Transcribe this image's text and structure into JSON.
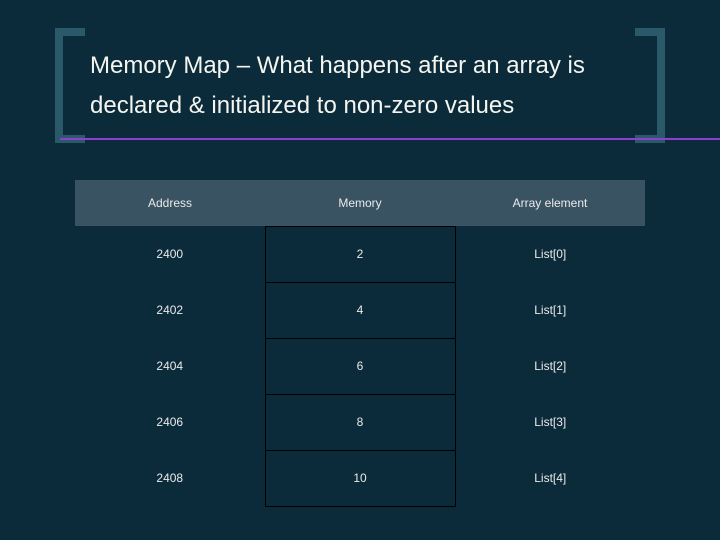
{
  "title": "Memory Map – What happens after an array is declared & initialized to non-zero values",
  "headers": {
    "address": "Address",
    "memory": "Memory",
    "element": "Array element"
  },
  "rows": [
    {
      "address": "2400",
      "memory": "2",
      "element": "List[0]"
    },
    {
      "address": "2402",
      "memory": "4",
      "element": "List[1]"
    },
    {
      "address": "2404",
      "memory": "6",
      "element": "List[2]"
    },
    {
      "address": "2406",
      "memory": "8",
      "element": "List[3]"
    },
    {
      "address": "2408",
      "memory": "10",
      "element": "List[4]"
    }
  ]
}
